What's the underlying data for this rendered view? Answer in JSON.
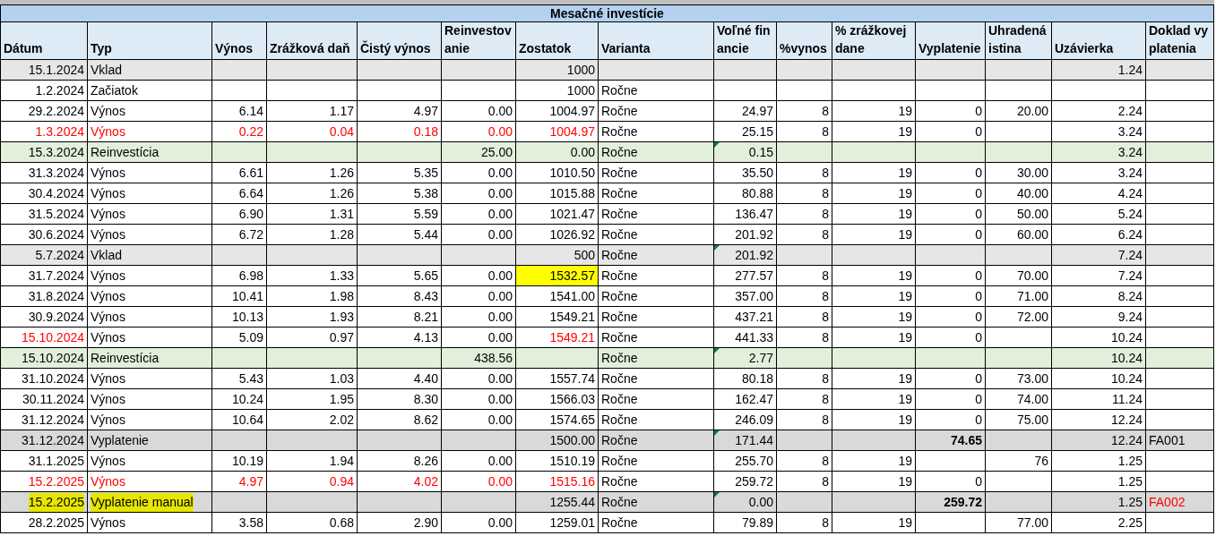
{
  "title": "Mesačné investície",
  "columns": [
    "Dátum",
    "Typ",
    "Výnos",
    "Zrážková daň",
    "Čistý výnos",
    "Reinvestovanie",
    "Zostatok",
    "Varianta",
    "Voľné financie",
    "%vynos",
    "% zrážkovej dane",
    "Vyplatenie",
    "Uhradená istina",
    "Uzávierka",
    "Doklad vyplatenia"
  ],
  "rows": [
    {
      "kind": "vklad",
      "cells": [
        "15.1.2024",
        "Vklad",
        null,
        null,
        null,
        null,
        "1000",
        null,
        null,
        null,
        null,
        null,
        null,
        "1.24",
        null
      ]
    },
    {
      "kind": "start",
      "cells": [
        "1.2.2024",
        "Začiatok",
        null,
        null,
        null,
        null,
        "1000",
        "Ročne",
        null,
        null,
        null,
        null,
        null,
        null,
        null
      ]
    },
    {
      "kind": "vynos",
      "cells": [
        "29.2.2024",
        "Výnos",
        "6.14",
        "1.17",
        "4.97",
        "0.00",
        "1004.97",
        "Ročne",
        "24.97",
        "8",
        "19",
        "0",
        "20.00",
        "2.24",
        null
      ]
    },
    {
      "kind": "vynos",
      "cells": [
        {
          "text": "1.3.2024",
          "red": true
        },
        {
          "text": "Výnos",
          "red": true
        },
        {
          "text": "0.22",
          "red": true
        },
        {
          "text": "0.04",
          "red": true
        },
        {
          "text": "0.18",
          "red": true
        },
        {
          "text": "0.00",
          "red": true
        },
        {
          "text": "1004.97",
          "red": true
        },
        "Ročne",
        "25.15",
        "8",
        "19",
        "0",
        null,
        "3.24",
        null
      ]
    },
    {
      "kind": "reinvesticia",
      "cells": [
        "15.3.2024",
        "Reinvestícia",
        null,
        null,
        null,
        "25.00",
        "0.00",
        "Ročne",
        {
          "text": "0.15",
          "note": true
        },
        null,
        null,
        null,
        null,
        "3.24",
        null
      ]
    },
    {
      "kind": "vynos",
      "cells": [
        "31.3.2024",
        "Výnos",
        "6.61",
        "1.26",
        "5.35",
        "0.00",
        "1010.50",
        "Ročne",
        "35.50",
        "8",
        "19",
        "0",
        "30.00",
        "3.24",
        null
      ]
    },
    {
      "kind": "vynos",
      "cells": [
        "30.4.2024",
        "Výnos",
        "6.64",
        "1.26",
        "5.38",
        "0.00",
        "1015.88",
        "Ročne",
        "80.88",
        "8",
        "19",
        "0",
        "40.00",
        "4.24",
        null
      ]
    },
    {
      "kind": "vynos",
      "cells": [
        "31.5.2024",
        "Výnos",
        "6.90",
        "1.31",
        "5.59",
        "0.00",
        "1021.47",
        "Ročne",
        "136.47",
        "8",
        "19",
        "0",
        "50.00",
        "5.24",
        null
      ]
    },
    {
      "kind": "vynos",
      "cells": [
        "30.6.2024",
        "Výnos",
        "6.72",
        "1.28",
        "5.44",
        "0.00",
        "1026.92",
        "Ročne",
        "201.92",
        "8",
        "19",
        "0",
        "60.00",
        "6.24",
        null
      ]
    },
    {
      "kind": "vklad",
      "cells": [
        "5.7.2024",
        "Vklad",
        null,
        null,
        null,
        null,
        "500",
        "Ročne",
        {
          "text": "201.92",
          "note": true
        },
        null,
        null,
        null,
        null,
        "7.24",
        null
      ]
    },
    {
      "kind": "vynos",
      "cells": [
        "31.7.2024",
        "Výnos",
        "6.98",
        "1.33",
        "5.65",
        "0.00",
        {
          "text": "1532.57",
          "highlight": true
        },
        "Ročne",
        "277.57",
        "8",
        "19",
        "0",
        "70.00",
        "7.24",
        null
      ]
    },
    {
      "kind": "vynos",
      "cells": [
        "31.8.2024",
        "Výnos",
        "10.41",
        "1.98",
        "8.43",
        "0.00",
        "1541.00",
        "Ročne",
        "357.00",
        "8",
        "19",
        "0",
        "71.00",
        "8.24",
        null
      ]
    },
    {
      "kind": "vynos",
      "cells": [
        "30.9.2024",
        "Výnos",
        "10.13",
        "1.93",
        "8.21",
        "0.00",
        "1549.21",
        "Ročne",
        "437.21",
        "8",
        "19",
        "0",
        "72.00",
        "9.24",
        null
      ]
    },
    {
      "kind": "vynos",
      "cells": [
        {
          "text": "15.10.2024",
          "red": true
        },
        "Výnos",
        "5.09",
        "0.97",
        "4.13",
        "0.00",
        {
          "text": "1549.21",
          "red": true
        },
        "Ročne",
        "441.33",
        "8",
        "19",
        "0",
        null,
        "10.24",
        null
      ]
    },
    {
      "kind": "reinvesticia",
      "cells": [
        "15.10.2024",
        "Reinvestícia",
        null,
        null,
        null,
        "438.56",
        null,
        "Ročne",
        {
          "text": "2.77",
          "note": true
        },
        null,
        null,
        null,
        null,
        "10.24",
        null
      ]
    },
    {
      "kind": "vynos",
      "cells": [
        "31.10.2024",
        "Výnos",
        "5.43",
        "1.03",
        "4.40",
        "0.00",
        "1557.74",
        "Ročne",
        "80.18",
        "8",
        "19",
        "0",
        "73.00",
        "10.24",
        null
      ]
    },
    {
      "kind": "vynos",
      "cells": [
        "30.11.2024",
        "Výnos",
        "10.24",
        "1.95",
        "8.30",
        "0.00",
        "1566.03",
        "Ročne",
        "162.47",
        "8",
        "19",
        "0",
        "74.00",
        "11.24",
        null
      ]
    },
    {
      "kind": "vynos",
      "cells": [
        "31.12.2024",
        "Výnos",
        "10.64",
        "2.02",
        "8.62",
        "0.00",
        "1574.65",
        "Ročne",
        "246.09",
        "8",
        "19",
        "0",
        "75.00",
        "12.24",
        null
      ]
    },
    {
      "kind": "vyplatenie",
      "cells": [
        "31.12.2024",
        "Vyplatenie",
        null,
        null,
        null,
        null,
        "1500.00",
        "Ročne",
        {
          "text": "171.44",
          "note": true
        },
        null,
        null,
        {
          "text": "74.65",
          "bold": true
        },
        null,
        "12.24",
        "FA001"
      ]
    },
    {
      "kind": "vynos",
      "cells": [
        "31.1.2025",
        "Výnos",
        "10.19",
        "1.94",
        "8.26",
        "0.00",
        "1510.19",
        "Ročne",
        "255.70",
        "8",
        "19",
        null,
        "76",
        "1.25",
        null
      ]
    },
    {
      "kind": "vynos",
      "cells": [
        {
          "text": "15.2.2025",
          "red": true
        },
        {
          "text": "Výnos",
          "red": true
        },
        {
          "text": "4.97",
          "red": true
        },
        {
          "text": "0.94",
          "red": true
        },
        {
          "text": "4.02",
          "red": true
        },
        {
          "text": "0.00",
          "red": true
        },
        {
          "text": "1515.16",
          "red": true
        },
        "Ročne",
        "259.72",
        "8",
        "19",
        "0",
        null,
        "1.25",
        null
      ]
    },
    {
      "kind": "vyplatenie",
      "cells": [
        {
          "text": "15.2.2025",
          "marker": true
        },
        {
          "text": "Vyplatenie manual",
          "marker": true
        },
        null,
        null,
        null,
        null,
        "1255.44",
        "Ročne",
        {
          "text": "0.00",
          "note": true
        },
        null,
        null,
        {
          "text": "259.72",
          "bold": true
        },
        null,
        "1.25",
        {
          "text": "FA002",
          "red": true
        }
      ]
    },
    {
      "kind": "vynos",
      "cells": [
        "28.2.2025",
        "Výnos",
        "3.58",
        "0.68",
        "2.90",
        "0.00",
        "1259.01",
        "Ročne",
        "79.89",
        "8",
        "19",
        null,
        "77.00",
        "2.25",
        null
      ]
    }
  ]
}
